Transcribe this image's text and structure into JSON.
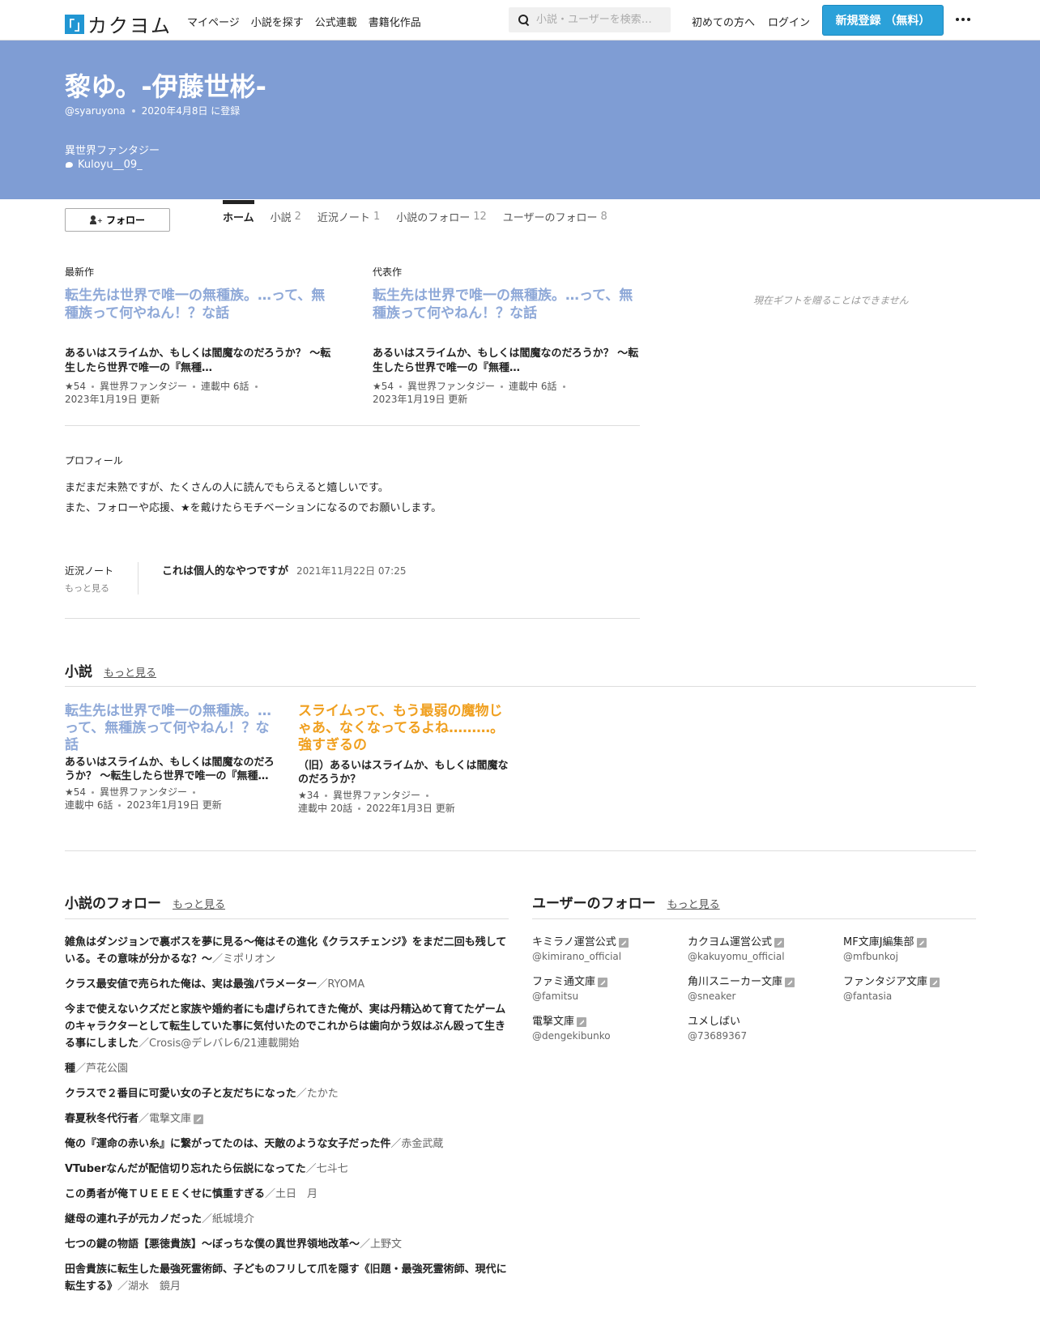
{
  "header": {
    "logo_mark": "「」",
    "logo_text": "カクヨム",
    "nav": [
      "マイページ",
      "小説を探す",
      "公式連載",
      "書籍化作品"
    ],
    "search_placeholder": "小説・ユーザーを検索…",
    "first_time": "初めての方へ",
    "login": "ログイン",
    "signup": "新規登録 （無料）"
  },
  "profile": {
    "name": "黎ゆ。-伊藤世彬-",
    "handle": "@syaruyona",
    "registered": "2020年4月8日 に登録",
    "genre": "異世界ファンタジー",
    "twitter": "Kuloyu__09_",
    "banner_color": "#7f9dd4"
  },
  "actions": {
    "follow": "フォロー"
  },
  "tabs": [
    {
      "label": "ホーム",
      "count": ""
    },
    {
      "label": "小説",
      "count": "2"
    },
    {
      "label": "近況ノート",
      "count": "1"
    },
    {
      "label": "小説のフォロー",
      "count": "12"
    },
    {
      "label": "ユーザーのフォロー",
      "count": "8"
    }
  ],
  "latest": {
    "label": "最新作",
    "title": "転生先は世界で唯一の無種族。…って、無種族って何やねん！？な話",
    "catch": "あるいはスライムか、もしくは閻魔なのだろうか？ 〜転生したら世界で唯一の『無種…",
    "stars": "★54",
    "genre": "異世界ファンタジー",
    "status": "連載中 6話",
    "updated": "2023年1月19日 更新"
  },
  "featured": {
    "label": "代表作",
    "title": "転生先は世界で唯一の無種族。…って、無種族って何やねん！？な話",
    "catch": "あるいはスライムか、もしくは閻魔なのだろうか？ 〜転生したら世界で唯一の『無種…",
    "stars": "★54",
    "genre": "異世界ファンタジー",
    "status": "連載中 6話",
    "updated": "2023年1月19日 更新"
  },
  "gift_note": "現在ギフトを贈ることはできません",
  "profile_section": {
    "label": "プロフィール",
    "lines": [
      "まだまだ未熟ですが、たくさんの人に読んでもらえると嬉しいです。",
      "また、フォローや応援、★を戴けたらモチベーションになるのでお願いします。"
    ]
  },
  "notes": {
    "label": "近況ノート",
    "more": "もっと見る",
    "title": "これは個人的なやつですが",
    "date": "2021年11月22日 07:25"
  },
  "novels": {
    "title": "小説",
    "more": "もっと見る",
    "items": [
      {
        "title": "転生先は世界で唯一の無種族。…って、無種族って何やねん！？な話",
        "catch": "あるいはスライムか、もしくは閻魔なのだろうか？ 〜転生したら世界で唯一の『無種…",
        "stars": "★54",
        "genre": "異世界ファンタジー",
        "status": "連載中 6話",
        "updated": "2023年1月19日 更新",
        "color": "#8fa9d8"
      },
      {
        "title": "スライムって、もう最弱の魔物じゃあ、なくなってるよね………。強すぎるの",
        "catch": "（旧）あるいはスライムか、もしくは閻魔なのだろうか？",
        "stars": "★34",
        "genre": "異世界ファンタジー",
        "status": "連載中 20話",
        "updated": "2022年1月3日 更新",
        "color": "#f0a020"
      }
    ]
  },
  "novel_follows": {
    "title": "小説のフォロー",
    "more": "もっと見る",
    "items": [
      {
        "title": "雑魚はダンジョンで裏ボスを夢に見る～俺はその進化《クラスチェンジ》をまだ二回も残している。その意味が分かるな？～",
        "author": "／ミポリオン",
        "official": false
      },
      {
        "title": "クラス最安値で売られた俺は、実は最強パラメーター",
        "author": "／RYOMA",
        "official": false
      },
      {
        "title": "今まで使えないクズだと家族や婚約者にも虐げられてきた俺が、実は丹精込めて育てたゲームのキャラクターとして転生していた事に気付いたのでこれからは歯向かう奴はぶん殴って生きる事にしました",
        "author": "／Crosis@デレバレ6/21連載開始",
        "official": false
      },
      {
        "title": "種",
        "author": "／芦花公園",
        "official": false
      },
      {
        "title": "クラスで２番目に可愛い女の子と友だちになった",
        "author": "／たかた",
        "official": false
      },
      {
        "title": "春夏秋冬代行者",
        "author": "／電撃文庫",
        "official": true
      },
      {
        "title": "俺の『運命の赤い糸』に繋がってたのは、天敵のような女子だった件",
        "author": "／赤金武蔵",
        "official": false
      },
      {
        "title": "VTuberなんだが配信切り忘れたら伝説になってた",
        "author": "／七斗七",
        "official": false
      },
      {
        "title": "この勇者が俺ＴＵＥＥＥくせに慎重すぎる",
        "author": "／土日　月",
        "official": false
      },
      {
        "title": "継母の連れ子が元カノだった",
        "author": "／紙城境介",
        "official": false
      },
      {
        "title": "七つの鍵の物語【悪徳貴族】～ぼっちな僕の異世界領地改革～",
        "author": "／上野文",
        "official": false
      },
      {
        "title": "田舎貴族に転生した最強死霊術師、子どものフリして爪を隠す《旧題・最強死霊術師、現代に転生する》",
        "author": "／湖水　鏡月",
        "official": false
      }
    ]
  },
  "user_follows": {
    "title": "ユーザーのフォロー",
    "more": "もっと見る",
    "items": [
      {
        "name": "キミラノ運営公式",
        "id": "@kimirano_official",
        "official": true
      },
      {
        "name": "カクヨム運営公式",
        "id": "@kakuyomu_official",
        "official": true
      },
      {
        "name": "MF文庫J編集部",
        "id": "@mfbunkoj",
        "official": true
      },
      {
        "name": "ファミ通文庫",
        "id": "@famitsu",
        "official": true
      },
      {
        "name": "角川スニーカー文庫",
        "id": "@sneaker",
        "official": true
      },
      {
        "name": "ファンタジア文庫",
        "id": "@fantasia",
        "official": true
      },
      {
        "name": "電撃文庫",
        "id": "@dengekibunko",
        "official": true
      },
      {
        "name": "ユメしばい",
        "id": "@73689367",
        "official": false
      }
    ]
  }
}
